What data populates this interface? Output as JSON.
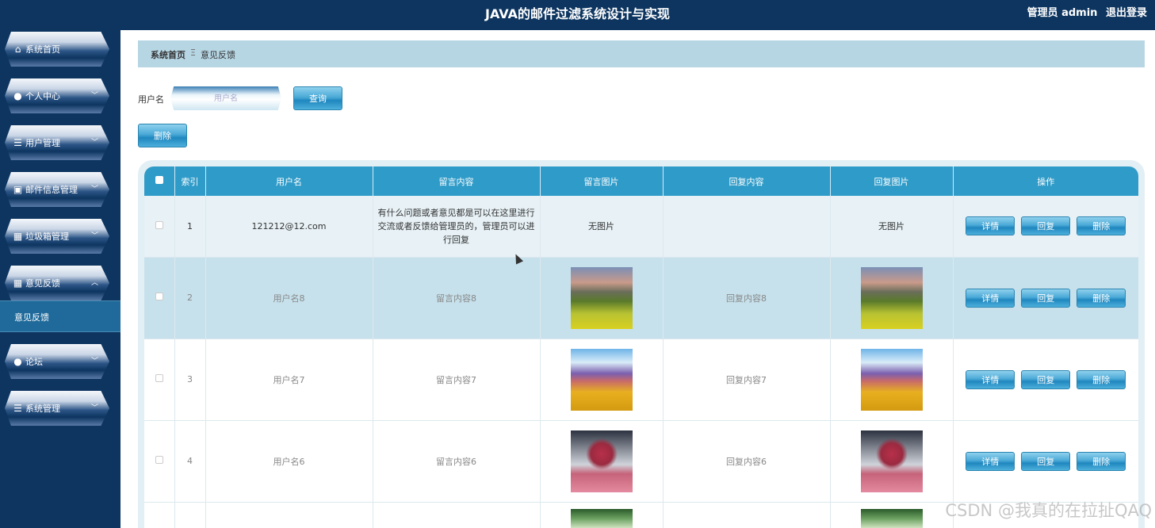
{
  "header": {
    "title": "JAVA的邮件过滤系统设计与实现",
    "role": "管理员 admin",
    "logout": "退出登录"
  },
  "sidebar": {
    "items": [
      {
        "label": "系统首页",
        "icon": "home-icon"
      },
      {
        "label": "个人中心",
        "icon": "user-icon"
      },
      {
        "label": "用户管理",
        "icon": "list-icon"
      },
      {
        "label": "邮件信息管理",
        "icon": "clipboard-icon"
      },
      {
        "label": "垃圾箱管理",
        "icon": "grid-icon"
      },
      {
        "label": "意见反馈",
        "icon": "grid-icon"
      },
      {
        "label": "论坛",
        "icon": "user-icon"
      },
      {
        "label": "系统管理",
        "icon": "list-icon"
      }
    ],
    "active_sub": "意见反馈"
  },
  "breadcrumb": {
    "home": "系统首页",
    "separator": "Ξ",
    "current": "意见反馈"
  },
  "search": {
    "label": "用户名",
    "placeholder": "用户名",
    "query_label": "查询"
  },
  "toolbar": {
    "delete_label": "删除"
  },
  "table": {
    "columns": [
      "索引",
      "用户名",
      "留言内容",
      "留言图片",
      "回复内容",
      "回复图片",
      "操作"
    ],
    "rows": [
      {
        "index": "1",
        "username": "121212@12.com",
        "content": "有什么问题或者意见都是可以在这里进行交流或者反馈给管理员的，管理员可以进行回复",
        "image": "无图片",
        "reply": "",
        "reply_image": "无图片"
      },
      {
        "index": "2",
        "username": "用户名8",
        "content": "留言内容8",
        "reply": "回复内容8",
        "image_name": "mountain-landscape-image"
      },
      {
        "index": "3",
        "username": "用户名7",
        "content": "留言内容7",
        "reply": "回复内容7",
        "image_name": "flower-field-image"
      },
      {
        "index": "4",
        "username": "用户名6",
        "content": "留言内容6",
        "reply": "回复内容6",
        "image_name": "pink-tree-image"
      },
      {
        "index": "",
        "username": "",
        "content": "",
        "reply": "",
        "image_name": "forest-image"
      }
    ],
    "actions": {
      "detail": "详情",
      "reply": "回复",
      "delete": "删除"
    }
  },
  "watermark": "CSDN @我真的在拉扯QAQ"
}
